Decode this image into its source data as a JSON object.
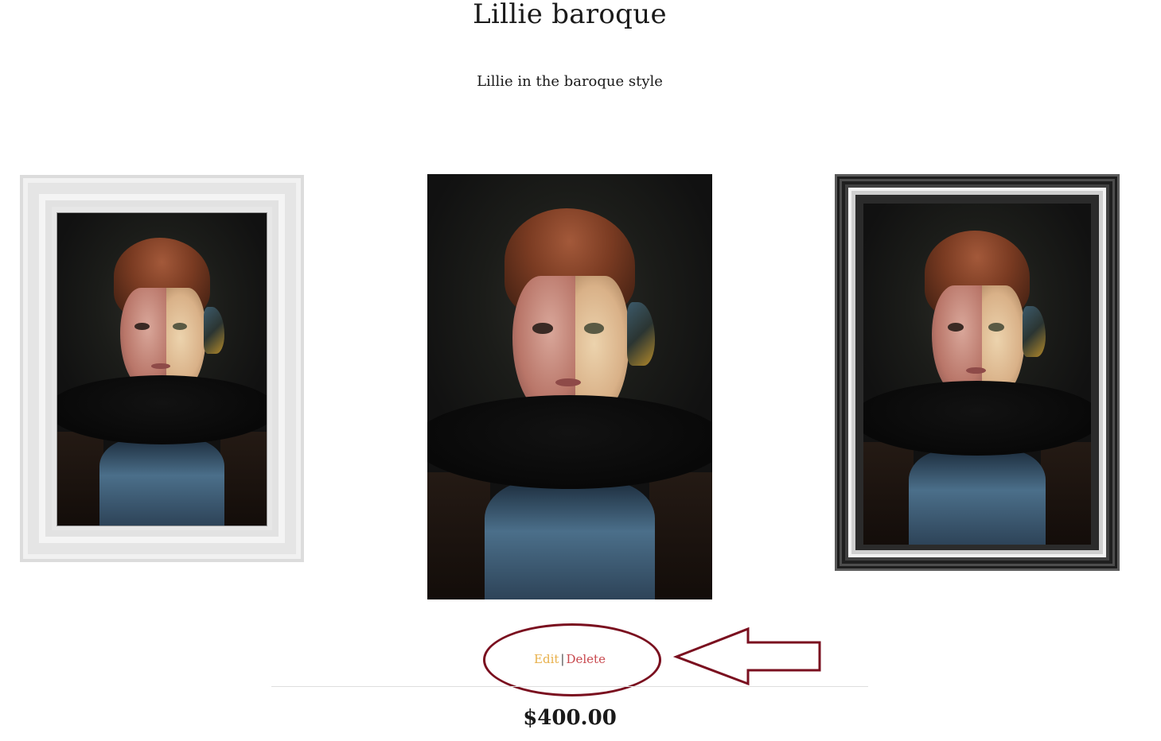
{
  "product": {
    "title": "Lillie baroque",
    "description": "Lillie in the baroque style",
    "price": "$400.00"
  },
  "gallery": {
    "images": [
      {
        "name": "white-frame-variant"
      },
      {
        "name": "unframed-variant"
      },
      {
        "name": "black-frame-variant"
      }
    ]
  },
  "actions": {
    "edit_label": "Edit",
    "separator": "|",
    "delete_label": "Delete"
  },
  "colors": {
    "edit": "#e8b04a",
    "delete": "#c8484e",
    "annotation": "#7a0f1f"
  }
}
